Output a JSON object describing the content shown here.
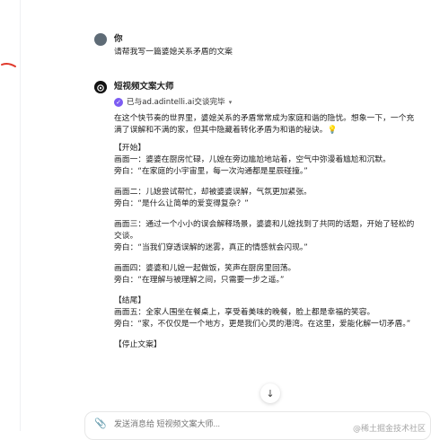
{
  "user_message": {
    "name": "你",
    "text": "请帮我写一篇婆媳关系矛盾的文案"
  },
  "bot_message": {
    "name": "短视频文案大师",
    "connected": "已与ad.adintelli.ai交谈完毕",
    "content_lines": [
      "在这个快节奏的世界里，婆媳关系的矛盾常常成为家庭和谐的隐忧。想象一下，一个充",
      "满了误解和不满的家，但其中隐藏着转化矛盾为和谐的秘诀。💡",
      "【开始】",
      "画面一：婆婆在厨房忙碌，儿媳在旁边尴尬地站着，空气中弥漫着尴尬和沉默。",
      "旁白：“在家庭的小宇宙里，每一次沟通都是星辰碰撞。”",
      "画面二：儿媳尝试帮忙，却被婆婆误解，气氛更加紧张。",
      "旁白：“是什么让简单的爱变得复杂？”",
      "画面三：通过一个小小的误会解释场景，婆婆和儿媳找到了共同的话题，开始了轻松的",
      "交谈。",
      "旁白：“当我们穿透误解的迷雾，真正的情感就会闪现。”",
      "画面四：婆婆和儿媳一起做饭，笑声在厨房里回荡。",
      "旁白：“在理解与被理解之间，只需要一步之遥。”",
      "【结尾】",
      "画面五：全家人围坐在餐桌上，享受着美味的晚餐，脸上都是幸福的笑容。",
      "旁白：“家，不仅仅是一个地方，更是我们心灵的港湾。在这里，爱能化解一切矛盾。”",
      "【停止文案】"
    ]
  },
  "input": {
    "placeholder": "发送消息给 短视频文案大师..."
  },
  "watermark": "@稀土掘金技术社区",
  "colors": {
    "accent": "#7c5cf2",
    "annotation": "#e0392b"
  },
  "icons": {
    "connected": "check-circle-icon",
    "scroll": "arrow-down-icon",
    "attach": "paperclip-icon"
  }
}
